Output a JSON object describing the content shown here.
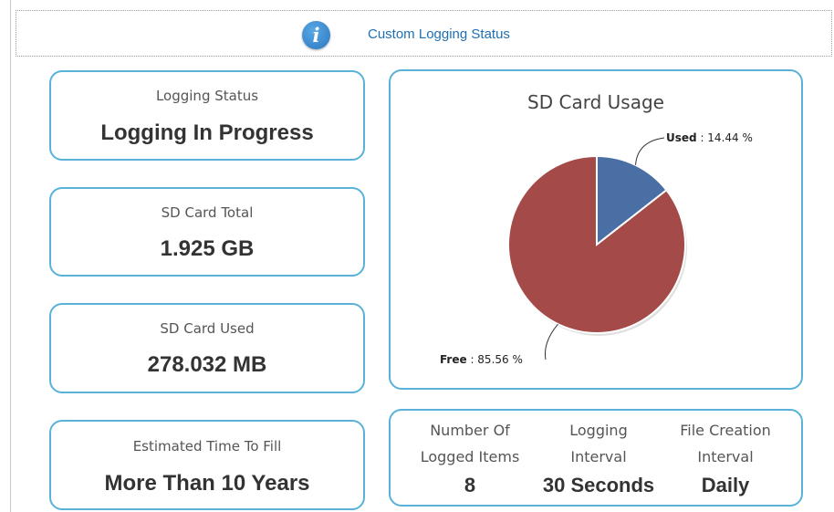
{
  "header": {
    "title": "Custom Logging Status",
    "icon": "info-icon",
    "icon_glyph": "i"
  },
  "cards": {
    "logging_status": {
      "label": "Logging Status",
      "value": "Logging In Progress"
    },
    "sd_total": {
      "label": "SD Card Total",
      "value": "1.925 GB"
    },
    "sd_used": {
      "label": "SD Card Used",
      "value": "278.032 MB"
    },
    "time_to_fill": {
      "label": "Estimated Time To Fill",
      "value": "More Than 10 Years"
    }
  },
  "stats": {
    "logged_items": {
      "label_line1": "Number Of",
      "label_line2": "Logged Items",
      "value": "8"
    },
    "logging_interval": {
      "label_line1": "Logging",
      "label_line2": "Interval",
      "value": "30 Seconds"
    },
    "file_creation": {
      "label_line1": "File Creation",
      "label_line2": "Interval",
      "value": "Daily"
    }
  },
  "colors": {
    "accent_border": "#5ab2d9",
    "header_text": "#1f6fb3",
    "used_slice": "#4a6fa5",
    "free_slice": "#a44a48"
  },
  "chart_data": {
    "type": "pie",
    "title": "SD Card Usage",
    "slices": [
      {
        "name": "Used",
        "value": 14.44,
        "label": "Used",
        "value_text": ": 14.44 %",
        "color": "#4a6fa5"
      },
      {
        "name": "Free",
        "value": 85.56,
        "label": "Free",
        "value_text": ": 85.56 %",
        "color": "#a44a48"
      }
    ]
  }
}
